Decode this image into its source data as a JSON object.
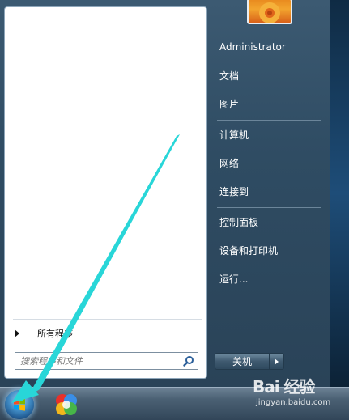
{
  "start_menu": {
    "all_programs_label": "所有程序",
    "search": {
      "placeholder": "搜索程序和文件"
    },
    "right_items": [
      {
        "label": "Administrator"
      },
      {
        "label": "文档"
      },
      {
        "label": "图片"
      },
      {
        "label": "计算机"
      },
      {
        "label": "网络"
      },
      {
        "label": "连接到"
      },
      {
        "label": "控制面板"
      },
      {
        "label": "设备和打印机"
      },
      {
        "label": "运行..."
      }
    ],
    "shutdown_label": "关机"
  },
  "watermark": {
    "logo_text": "Bai 经验",
    "url": "jingyan.baidu.com"
  },
  "colors": {
    "annotation_arrow": "#28d6d8",
    "menu_frame": "#3c5a72",
    "taskbar": "#4b6174"
  },
  "icons": {
    "start": "windows-orb-icon",
    "search": "search-icon",
    "taskbar_app": "colorful-app-icon"
  }
}
